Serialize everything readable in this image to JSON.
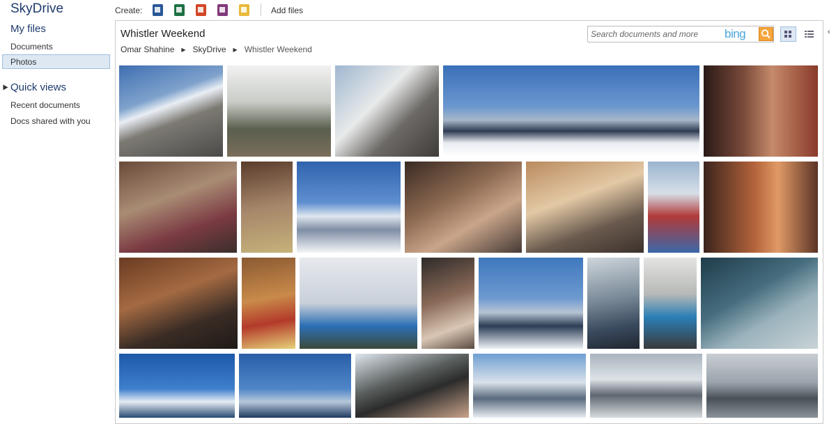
{
  "sidebar": {
    "brand": "SkyDrive",
    "my_files": "My files",
    "items": [
      "Documents",
      "Photos"
    ],
    "selected": "Photos",
    "quick_views": "Quick views",
    "quick_items": [
      "Recent documents",
      "Docs shared with you"
    ]
  },
  "commandbar": {
    "create_label": "Create:",
    "create_icons": [
      {
        "name": "word-document-icon",
        "color": "#2b5797"
      },
      {
        "name": "excel-workbook-icon",
        "color": "#1e7145"
      },
      {
        "name": "powerpoint-presentation-icon",
        "color": "#d24726"
      },
      {
        "name": "onenote-notebook-icon",
        "color": "#80397b"
      },
      {
        "name": "folder-icon",
        "color": "#e8b93a"
      }
    ],
    "add_files": "Add files"
  },
  "panel": {
    "title": "Whistler Weekend",
    "breadcrumb": [
      "Omar Shahine",
      "SkyDrive",
      "Whistler Weekend"
    ],
    "search_placeholder": "Search documents and more",
    "search_brand": "bing"
  },
  "photos": [
    "mountain-ridge-photo",
    "skier-helmet-photo",
    "rock-cliff-photo",
    "mountain-panorama-photo",
    "portrait-photo",
    "couch-photo",
    "reading-photo",
    "snowy-peaks-photo",
    "couch-soda-photo",
    "phone-photo",
    "red-scarf-photo",
    "two-guys-photo",
    "kitchen-table-photo",
    "cooking-photo",
    "wind-snow-photo",
    "napping-photo",
    "mountain-range-photo",
    "car-door-photo",
    "walking-photo",
    "car-window-photo",
    "blue-mountain-photo",
    "peaks-photo",
    "helmet-sunglasses-photo",
    "cloudy-range-photo",
    "grey-mountain-photo",
    "gondola-photo"
  ],
  "colors": {
    "accent": "#1f3b6e",
    "selection": "#dde8f3",
    "search_button": "#f5a53b"
  }
}
